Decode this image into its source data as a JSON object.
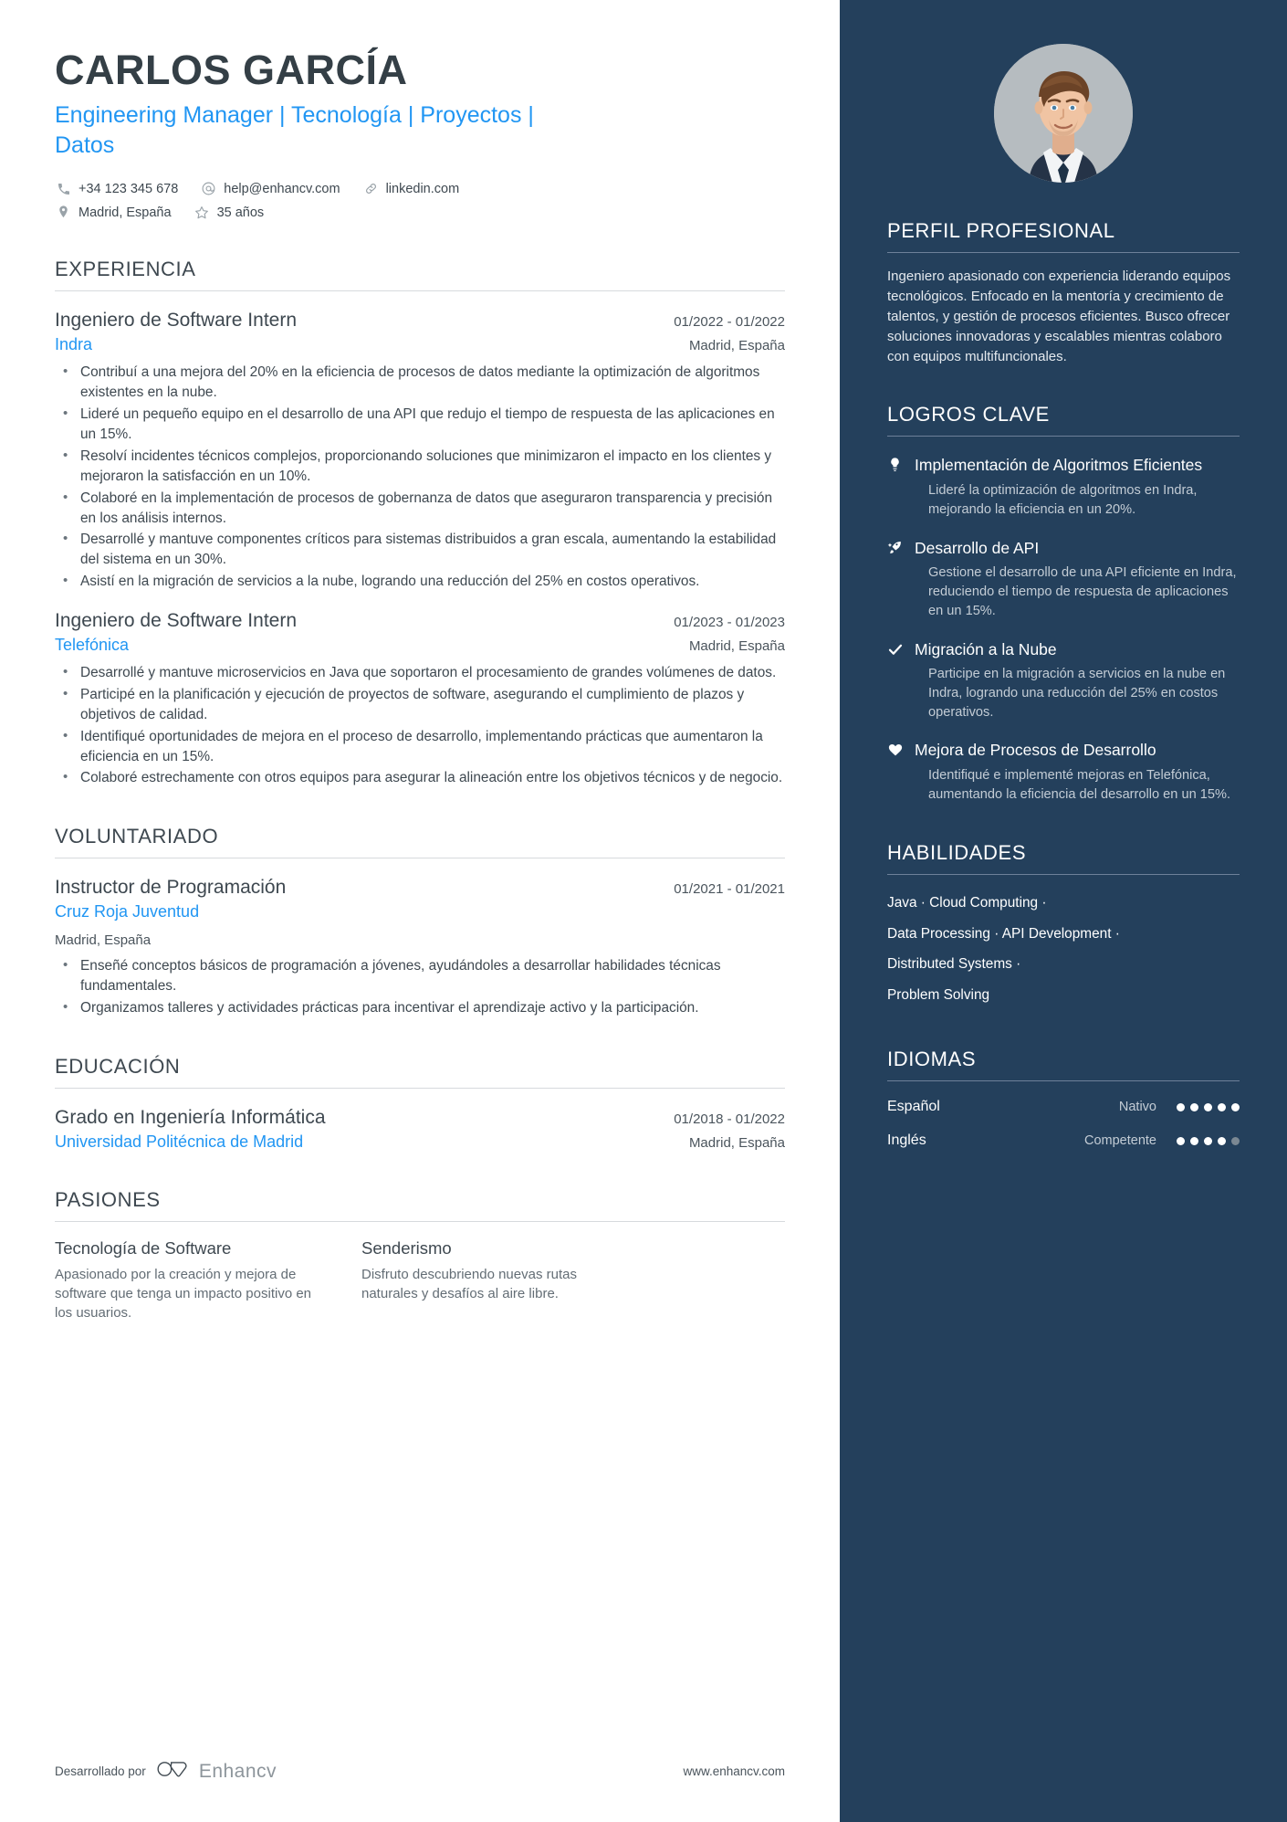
{
  "header": {
    "name": "CARLOS GARCÍA",
    "headline": "Engineering Manager | Tecnología | Proyectos | Datos",
    "contacts_row1": [
      {
        "icon": "phone-icon",
        "text": "+34 123 345 678"
      },
      {
        "icon": "email-icon",
        "text": "help@enhancv.com"
      },
      {
        "icon": "link-icon",
        "text": "linkedin.com"
      }
    ],
    "contacts_row2": [
      {
        "icon": "location-icon",
        "text": "Madrid, España"
      },
      {
        "icon": "star-icon",
        "text": "35 años"
      }
    ]
  },
  "experience": {
    "title": "EXPERIENCIA",
    "entries": [
      {
        "role": "Ingeniero de Software Intern",
        "date": "01/2022 - 01/2022",
        "company": "Indra",
        "location": "Madrid, España",
        "bullets": [
          "Contribuí a una mejora del 20% en la eficiencia de procesos de datos mediante la optimización de algoritmos existentes en la nube.",
          "Lideré un pequeño equipo en el desarrollo de una API que redujo el tiempo de respuesta de las aplicaciones en un 15%.",
          "Resolví incidentes técnicos complejos, proporcionando soluciones que minimizaron el impacto en los clientes y mejoraron la satisfacción en un 10%.",
          "Colaboré en la implementación de procesos de gobernanza de datos que aseguraron transparencia y precisión en los análisis internos.",
          "Desarrollé y mantuve componentes críticos para sistemas distribuidos a gran escala, aumentando la estabilidad del sistema en un 30%.",
          "Asistí en la migración de servicios a la nube, logrando una reducción del 25% en costos operativos."
        ]
      },
      {
        "role": "Ingeniero de Software Intern",
        "date": "01/2023 - 01/2023",
        "company": "Telefónica",
        "location": "Madrid, España",
        "bullets": [
          "Desarrollé y mantuve microservicios en Java que soportaron el procesamiento de grandes volúmenes de datos.",
          "Participé en la planificación y ejecución de proyectos de software, asegurando el cumplimiento de plazos y objetivos de calidad.",
          "Identifiqué oportunidades de mejora en el proceso de desarrollo, implementando prácticas que aumentaron la eficiencia en un 15%.",
          "Colaboré estrechamente con otros equipos para asegurar la alineación entre los objetivos técnicos y de negocio."
        ]
      }
    ]
  },
  "volunteering": {
    "title": "VOLUNTARIADO",
    "entries": [
      {
        "role": "Instructor de Programación",
        "date": "01/2021 - 01/2021",
        "company": "Cruz Roja Juventud",
        "location": "Madrid, España",
        "bullets": [
          "Enseñé conceptos básicos de programación a jóvenes, ayudándoles a desarrollar habilidades técnicas fundamentales.",
          "Organizamos talleres y actividades prácticas para incentivar el aprendizaje activo y la participación."
        ]
      }
    ]
  },
  "education": {
    "title": "EDUCACIÓN",
    "entries": [
      {
        "degree": "Grado en Ingeniería Informática",
        "date": "01/2018 - 01/2022",
        "school": "Universidad Politécnica de Madrid",
        "location": "Madrid, España"
      }
    ]
  },
  "passions": {
    "title": "PASIONES",
    "items": [
      {
        "title": "Tecnología de Software",
        "desc": "Apasionado por la creación y mejora de software que tenga un impacto positivo en los usuarios."
      },
      {
        "title": "Senderismo",
        "desc": "Disfruto descubriendo nuevas rutas naturales y desafíos al aire libre."
      }
    ]
  },
  "footer": {
    "by": "Desarrollado por",
    "brand": "Enhancv",
    "url": "www.enhancv.com"
  },
  "sidebar": {
    "profile": {
      "title": "PERFIL PROFESIONAL",
      "text": "Ingeniero apasionado con experiencia liderando equipos tecnológicos. Enfocado en la mentoría y crecimiento de talentos, y gestión de procesos eficientes. Busco ofrecer soluciones innovadoras y escalables mientras colaboro con equipos multifuncionales."
    },
    "achievements": {
      "title": "LOGROS CLAVE",
      "items": [
        {
          "icon": "lightbulb-icon",
          "title": "Implementación de Algoritmos Eficientes",
          "desc": "Lideré la optimización de algoritmos en Indra, mejorando la eficiencia en un 20%."
        },
        {
          "icon": "rocket-icon",
          "title": "Desarrollo de API",
          "desc": "Gestione el desarrollo de una API eficiente en Indra, reduciendo el tiempo de respuesta de aplicaciones en un 15%."
        },
        {
          "icon": "check-icon",
          "title": "Migración a la Nube",
          "desc": "Participe en la migración a servicios en la nube en Indra, logrando una reducción del 25% en costos operativos."
        },
        {
          "icon": "heart-icon",
          "title": "Mejora de Procesos de Desarrollo",
          "desc": "Identifiqué e implementé mejoras en Telefónica, aumentando la eficiencia del desarrollo en un 15%."
        }
      ]
    },
    "skills": {
      "title": "HABILIDADES",
      "lines": [
        "Java · Cloud Computing ·",
        "Data Processing · API Development ·",
        "Distributed Systems ·",
        "Problem Solving"
      ]
    },
    "languages": {
      "title": "IDIOMAS",
      "items": [
        {
          "name": "Español",
          "level": "Nativo",
          "filled": 5,
          "total": 5
        },
        {
          "name": "Inglés",
          "level": "Competente",
          "filled": 4,
          "total": 5
        }
      ]
    }
  },
  "colors": {
    "accent_blue": "#2196f3",
    "sidebar_bg": "#24405c",
    "text_dark": "#3e4850"
  }
}
